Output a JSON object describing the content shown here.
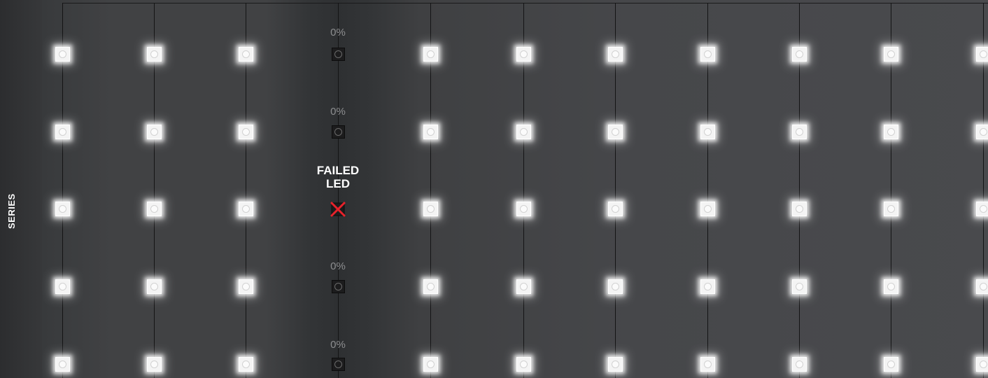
{
  "series_label": "SERIES",
  "failed_label_line1": "FAILED",
  "failed_label_line2": "LED",
  "off_percent": [
    "0%",
    "0%",
    "0%",
    "0%"
  ],
  "grid": {
    "columns": 11,
    "rows": 5,
    "failed_column": 4,
    "failed_row": 3,
    "off_led_level": 0
  },
  "colors": {
    "lit_led": "#ffffff",
    "failed_mark": "#e8222b",
    "percent_text": "#8d8e90"
  }
}
